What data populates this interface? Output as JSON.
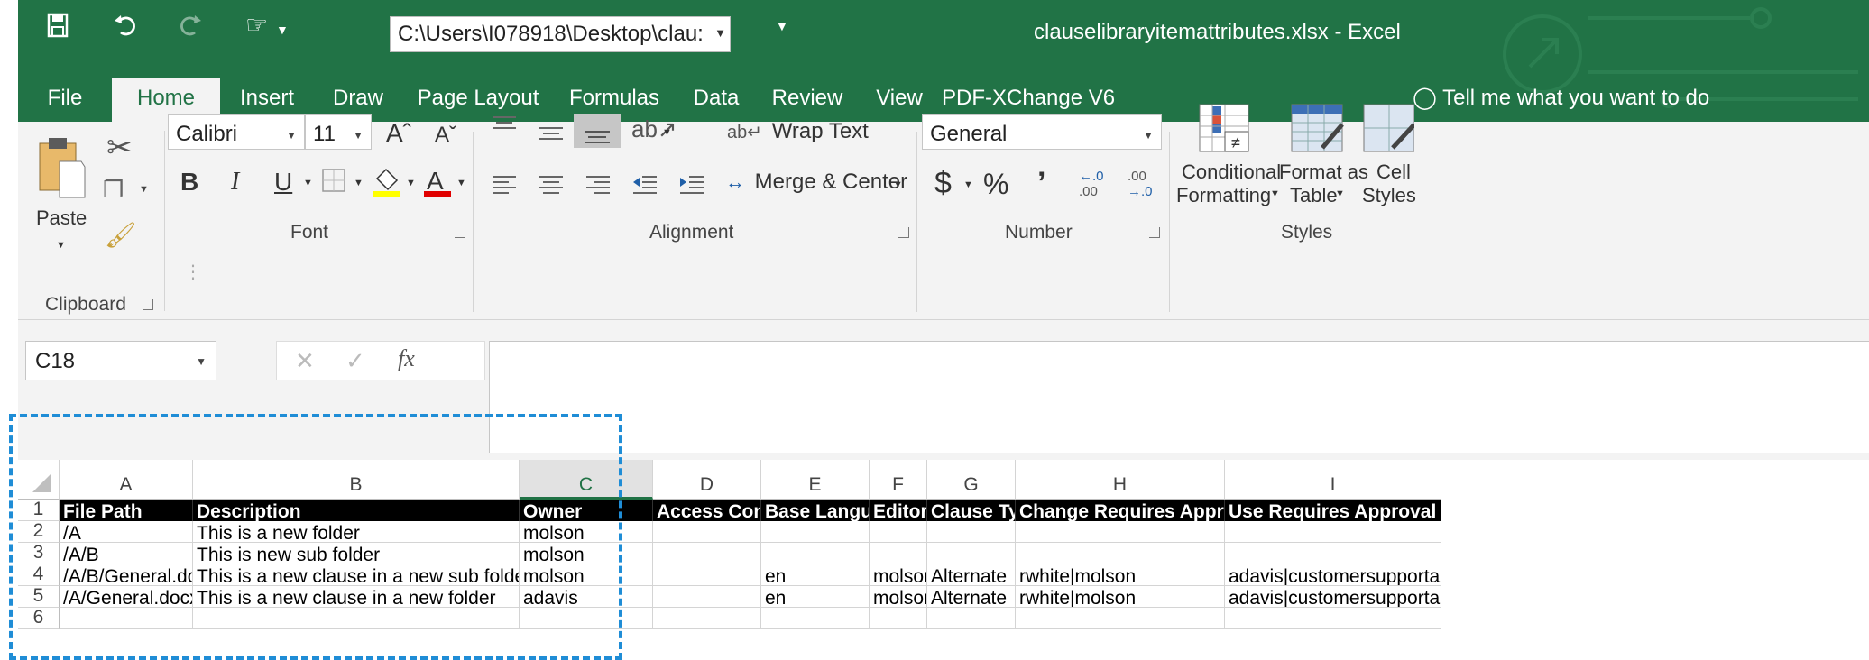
{
  "qat": {
    "path": "C:\\Users\\I078918\\Desktop\\clau:",
    "title": "clauselibraryitemattributes.xlsx  -  Excel"
  },
  "tabs": [
    "File",
    "Home",
    "Insert",
    "Draw",
    "Page Layout",
    "Formulas",
    "Data",
    "Review",
    "View",
    "PDF-XChange V6"
  ],
  "tell_me": "Tell me what you want to do",
  "ribbon": {
    "clipboard": {
      "paste": "Paste",
      "label": "Clipboard"
    },
    "font": {
      "name": "Calibri",
      "size": "11",
      "label": "Font",
      "bold": "B",
      "italic": "I",
      "underline": "U"
    },
    "alignment": {
      "wrap": "Wrap Text",
      "merge": "Merge & Center",
      "label": "Alignment"
    },
    "number": {
      "format": "General",
      "currency": "$",
      "percent": "%",
      "comma": "’",
      "label": "Number"
    },
    "styles": {
      "conditional_1": "Conditional",
      "conditional_2": "Formatting",
      "format_1": "Format as",
      "format_2": "Table",
      "cell_1": "Cell",
      "cell_2": "Styles",
      "label": "Styles"
    }
  },
  "formula_bar": {
    "name_box": "C18",
    "fx": "fx",
    "formula": ""
  },
  "sheet": {
    "columns": [
      "A",
      "B",
      "C",
      "D",
      "E",
      "F",
      "G",
      "H",
      "I"
    ],
    "rows": [
      [
        "File Path",
        "Description",
        "Owner",
        "Access Control",
        "Base Language",
        "Editors",
        "Clause Type",
        "Change Requires Approval By",
        "Use Requires Approval By"
      ],
      [
        "/A",
        "This is a new folder",
        "molson",
        "",
        "",
        "",
        "",
        "",
        ""
      ],
      [
        "/A/B",
        "This is new sub folder",
        "molson",
        "",
        "",
        "",
        "",
        "",
        ""
      ],
      [
        "/A/B/General.docx",
        "This is a new clause in a new sub folder",
        "molson",
        "",
        "en",
        "molson",
        "Alternate",
        "rwhite|molson",
        "adavis|customersupportadmin"
      ],
      [
        "/A/General.docx",
        "This is a new clause in a new folder",
        "adavis",
        "",
        "en",
        "molson",
        "Alternate",
        "rwhite|molson",
        "adavis|customersupportadmin"
      ]
    ],
    "row_numbers": [
      "1",
      "2",
      "3",
      "4",
      "5",
      "6"
    ]
  },
  "colors": {
    "excel_green": "#217346",
    "highlight_dashed": "#1f8dd6"
  }
}
